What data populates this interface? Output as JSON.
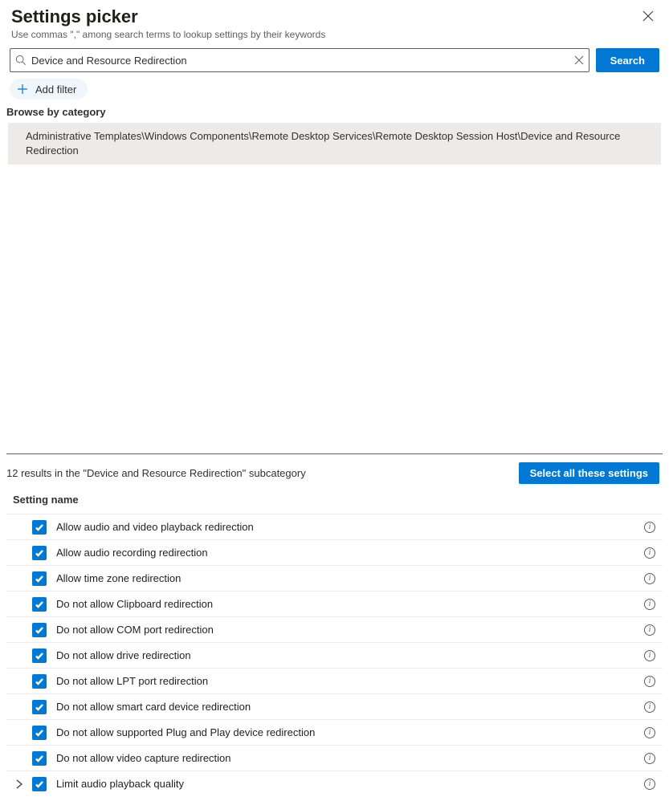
{
  "header": {
    "title": "Settings picker",
    "subtitle": "Use commas \",\" among search terms to lookup settings by their keywords"
  },
  "search": {
    "value": "Device and Resource Redirection",
    "button": "Search"
  },
  "filter": {
    "add_label": "Add filter"
  },
  "browse": {
    "label": "Browse by category",
    "category_path": "Administrative Templates\\Windows Components\\Remote Desktop Services\\Remote Desktop Session Host\\Device and Resource Redirection"
  },
  "results": {
    "summary": "12 results in the \"Device and Resource Redirection\" subcategory",
    "select_all": "Select all these settings",
    "column_header": "Setting name",
    "items": [
      {
        "name": "Allow audio and video playback redirection",
        "checked": true,
        "expandable": false
      },
      {
        "name": "Allow audio recording redirection",
        "checked": true,
        "expandable": false
      },
      {
        "name": "Allow time zone redirection",
        "checked": true,
        "expandable": false
      },
      {
        "name": "Do not allow Clipboard redirection",
        "checked": true,
        "expandable": false
      },
      {
        "name": "Do not allow COM port redirection",
        "checked": true,
        "expandable": false
      },
      {
        "name": "Do not allow drive redirection",
        "checked": true,
        "expandable": false
      },
      {
        "name": "Do not allow LPT port redirection",
        "checked": true,
        "expandable": false
      },
      {
        "name": "Do not allow smart card device redirection",
        "checked": true,
        "expandable": false
      },
      {
        "name": "Do not allow supported Plug and Play device redirection",
        "checked": true,
        "expandable": false
      },
      {
        "name": "Do not allow video capture redirection",
        "checked": true,
        "expandable": false
      },
      {
        "name": "Limit audio playback quality",
        "checked": true,
        "expandable": true
      }
    ]
  }
}
